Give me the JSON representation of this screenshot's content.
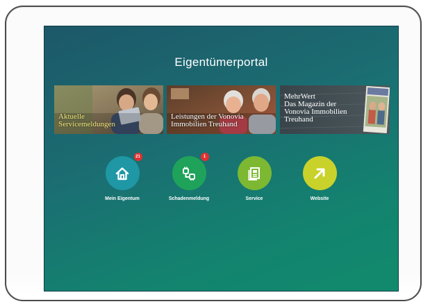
{
  "portal": {
    "title": "Eigentümerportal"
  },
  "tiles": [
    {
      "caption": "Aktuelle\nServicemeldungen"
    },
    {
      "caption": "Leistungen der Vonovia\nImmobilien Treuhand"
    },
    {
      "caption": "MehrWert\nDas Magazin der\nVonovia Immobilien\nTreuhand"
    }
  ],
  "actions": [
    {
      "label": "Mein Eigentum",
      "badge": "21",
      "icon": "house-icon",
      "color": "#1f97a5"
    },
    {
      "label": "Schadenmeldung",
      "badge": "1",
      "icon": "plug-icon",
      "color": "#1fa35a"
    },
    {
      "label": "Service",
      "badge": "",
      "icon": "document-icon",
      "color": "#7cb832"
    },
    {
      "label": "Website",
      "badge": "",
      "icon": "arrow-up-right-icon",
      "color": "#c9d22a"
    }
  ],
  "colors": {
    "badge": "#e3302f",
    "tile_caption_highlight": "#f2ea7c"
  }
}
